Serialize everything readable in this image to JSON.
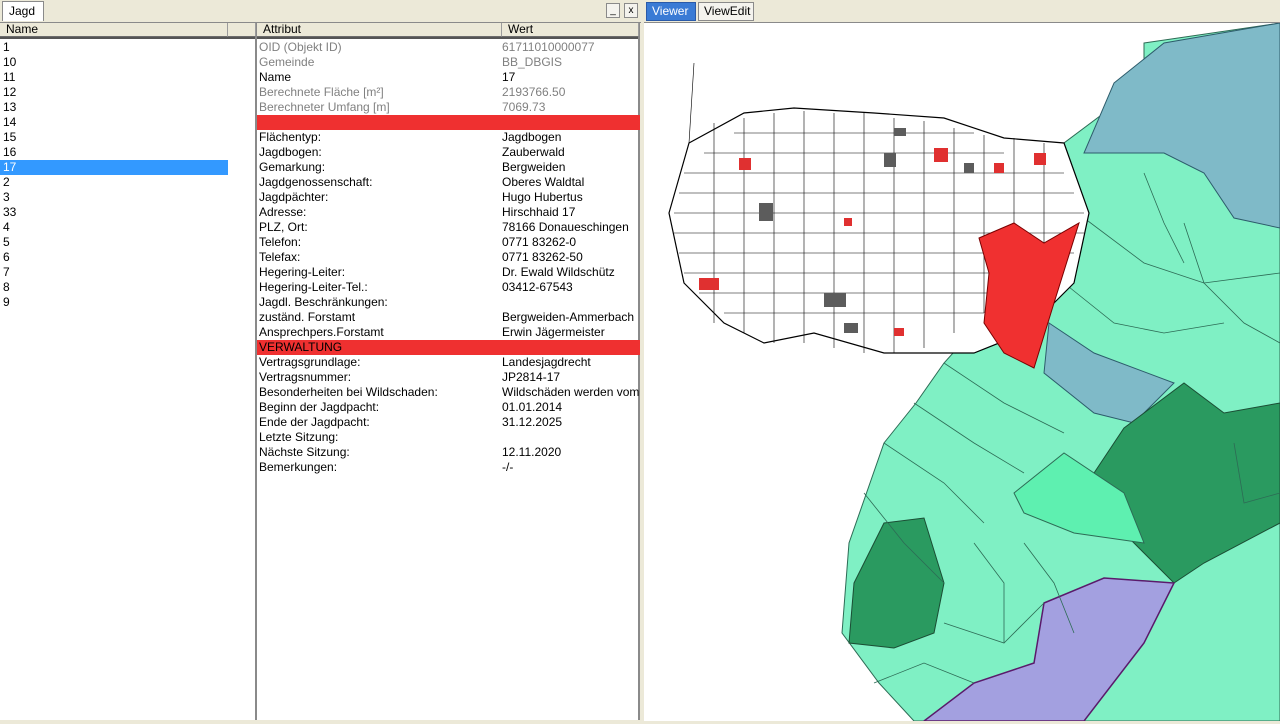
{
  "left_panel": {
    "tab_label": "Jagd",
    "minimize_label": "_",
    "close_label": "x",
    "list_header": "Name",
    "attr_header": "Attribut",
    "value_header": "Wert",
    "names": [
      "1",
      "10",
      "11",
      "12",
      "13",
      "14",
      "15",
      "16",
      "17",
      "2",
      "3",
      "33",
      "4",
      "5",
      "6",
      "7",
      "8",
      "9"
    ],
    "selected": "17"
  },
  "attributes": [
    {
      "key": "OID (Objekt ID)",
      "value": "61711010000077",
      "style": "grey"
    },
    {
      "key": "Gemeinde",
      "value": "BB_DBGIS",
      "style": "grey"
    },
    {
      "key": "Name",
      "value": "17",
      "style": "normal"
    },
    {
      "key": "Berechnete Fläche [m²]",
      "value": "2193766.50",
      "style": "grey"
    },
    {
      "key": "Berechneter Umfang [m]",
      "value": "7069.73",
      "style": "grey"
    },
    {
      "key": "",
      "value": "",
      "style": "sep"
    },
    {
      "key": "Flächentyp:",
      "value": "Jagdbogen",
      "style": "normal"
    },
    {
      "key": "Jagdbogen:",
      "value": "Zauberwald",
      "style": "normal"
    },
    {
      "key": "Gemarkung:",
      "value": "Bergweiden",
      "style": "normal"
    },
    {
      "key": "Jagdgenossenschaft:",
      "value": "Oberes Waldtal",
      "style": "normal"
    },
    {
      "key": "Jagdpächter:",
      "value": "Hugo Hubertus",
      "style": "normal"
    },
    {
      "key": "Adresse:",
      "value": "Hirschhaid 17",
      "style": "normal"
    },
    {
      "key": "PLZ, Ort:",
      "value": "78166 Donaueschingen",
      "style": "normal"
    },
    {
      "key": "Telefon:",
      "value": "0771 83262-0",
      "style": "normal"
    },
    {
      "key": "Telefax:",
      "value": "0771 83262-50",
      "style": "normal"
    },
    {
      "key": "Hegering-Leiter:",
      "value": "Dr. Ewald Wildschütz",
      "style": "normal"
    },
    {
      "key": "Hegering-Leiter-Tel.:",
      "value": "03412-67543",
      "style": "normal"
    },
    {
      "key": "Jagdl. Beschränkungen:",
      "value": "",
      "style": "normal"
    },
    {
      "key": "zuständ. Forstamt",
      "value": "Bergweiden-Ammerbach",
      "style": "normal"
    },
    {
      "key": "Ansprechpers.Forstamt",
      "value": "Erwin Jägermeister",
      "style": "normal"
    },
    {
      "key": "VERWALTUNG",
      "value": "",
      "style": "sep"
    },
    {
      "key": "Vertragsgrundlage:",
      "value": "Landesjagdrecht",
      "style": "normal"
    },
    {
      "key": "Vertragsnummer:",
      "value": "JP2814-17",
      "style": "normal"
    },
    {
      "key": "Besonderheiten bei Wildschaden:",
      "value": "Wildschäden werden vom",
      "style": "normal"
    },
    {
      "key": "Beginn der Jagdpacht:",
      "value": "01.01.2014",
      "style": "normal"
    },
    {
      "key": "Ende der Jagdpacht:",
      "value": "31.12.2025",
      "style": "normal"
    },
    {
      "key": "Letzte Sitzung:",
      "value": "",
      "style": "normal"
    },
    {
      "key": "Nächste Sitzung:",
      "value": "12.11.2020",
      "style": "normal"
    },
    {
      "key": "Bemerkungen:",
      "value": "-/-",
      "style": "normal"
    }
  ],
  "right_panel": {
    "tabs": [
      "Viewer",
      "ViewEdit"
    ],
    "active_tab": "Viewer"
  },
  "map": {
    "colors": {
      "light_green": "#7ff0c4",
      "dark_green": "#2a9a60",
      "grey_blue": "#7fbac8",
      "red": "#f03030",
      "purple": "#a3a0e0",
      "building": "#5c5c5c",
      "highlight_red": "#e03030"
    }
  }
}
